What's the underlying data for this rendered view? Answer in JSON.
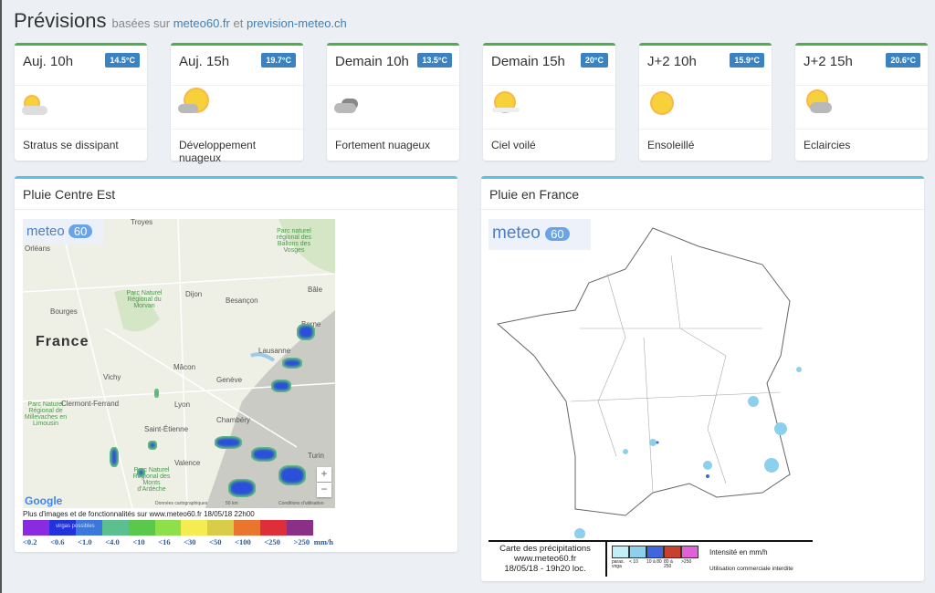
{
  "header": {
    "title": "Prévisions",
    "subtitle": "basées sur",
    "link1": "meteo60.fr",
    "and": "et",
    "link2": "prevision-meteo.ch"
  },
  "forecasts": [
    {
      "label": "Auj. 10h",
      "temp": "14.5°C",
      "icon": "sun-behind-fog-icon",
      "desc": "Stratus se dissipant"
    },
    {
      "label": "Auj. 15h",
      "temp": "19.7°C",
      "icon": "sun-with-clouds-icon",
      "desc": "Développement nuageux"
    },
    {
      "label": "Demain 10h",
      "temp": "13.5°C",
      "icon": "heavy-cloud-icon",
      "desc": "Fortement nuageux"
    },
    {
      "label": "Demain 15h",
      "temp": "20°C",
      "icon": "hazy-sun-icon",
      "desc": "Ciel voilé"
    },
    {
      "label": "J+2 10h",
      "temp": "15.9°C",
      "icon": "sun-icon",
      "desc": "Ensoleillé"
    },
    {
      "label": "J+2 15h",
      "temp": "20.6°C",
      "icon": "sun-behind-cloud-icon",
      "desc": "Eclaircies"
    }
  ],
  "colors": {
    "card_accent": "#4cae4c",
    "panel_accent": "#5bc0de",
    "badge": "#3b83c0"
  },
  "left_panel": {
    "title": "Pluie Centre Est",
    "logo": "meteo",
    "logo_num": "60",
    "country": "France",
    "cities": [
      "Troyes",
      "Orléans",
      "Dijon",
      "Besançon",
      "Bourges",
      "Berne",
      "Bâle",
      "Lausanne",
      "Mâcon",
      "Genève",
      "Vichy",
      "Clermont-Ferrand",
      "Lyon",
      "Saint-Étienne",
      "Chambéry",
      "Valence",
      "Turin"
    ],
    "parks": [
      "Parc Naturel Régional du Morvan",
      "Parc naturel régional des Ballons des Vosges",
      "Parc Naturel Régional de Millevaches en Limousin",
      "Parc Naturel Régional des Monts d'Ardèche"
    ],
    "google": "Google",
    "map_data": "Données cartographiques",
    "scale": "50 km",
    "terms": "Conditions d'utilisation",
    "zoom_in": "+",
    "zoom_out": "−",
    "credit": "Plus d'images et de fonctionnalités sur www.meteo60.fr 18/05/18 22h00",
    "virga": "virgas possibles",
    "scale_colors": [
      "#8a2be2",
      "#2233dd",
      "#3a78dd",
      "#5bbf8f",
      "#5ac84a",
      "#8ee04a",
      "#f4ec50",
      "#d9cc48",
      "#e9752f",
      "#e02d3a",
      "#8c2f86"
    ],
    "scale_labels": [
      "<0.2",
      "<0.6",
      "<1.0",
      "<4.0",
      "<10",
      "<16",
      "<30",
      "<50",
      "<100",
      "<250",
      ">250"
    ],
    "unit": "mm/h"
  },
  "right_panel": {
    "title": "Pluie en France",
    "logo": "meteo",
    "logo_num": "60",
    "caption": [
      "Carte des précipitations",
      "www.meteo60.fr",
      "18/05/18 - 19h20 loc."
    ],
    "legend_colors": [
      "#c4eef7",
      "#8dd0ee",
      "#3f66dd",
      "#c8402e",
      "#e060d8"
    ],
    "legend_labels": [
      "paras. virga",
      "< 10",
      "10 à 80",
      "80 à 250",
      ">250"
    ],
    "intensity": "Intensité en mm/h",
    "notice": "Utilisation commerciale interdite"
  }
}
